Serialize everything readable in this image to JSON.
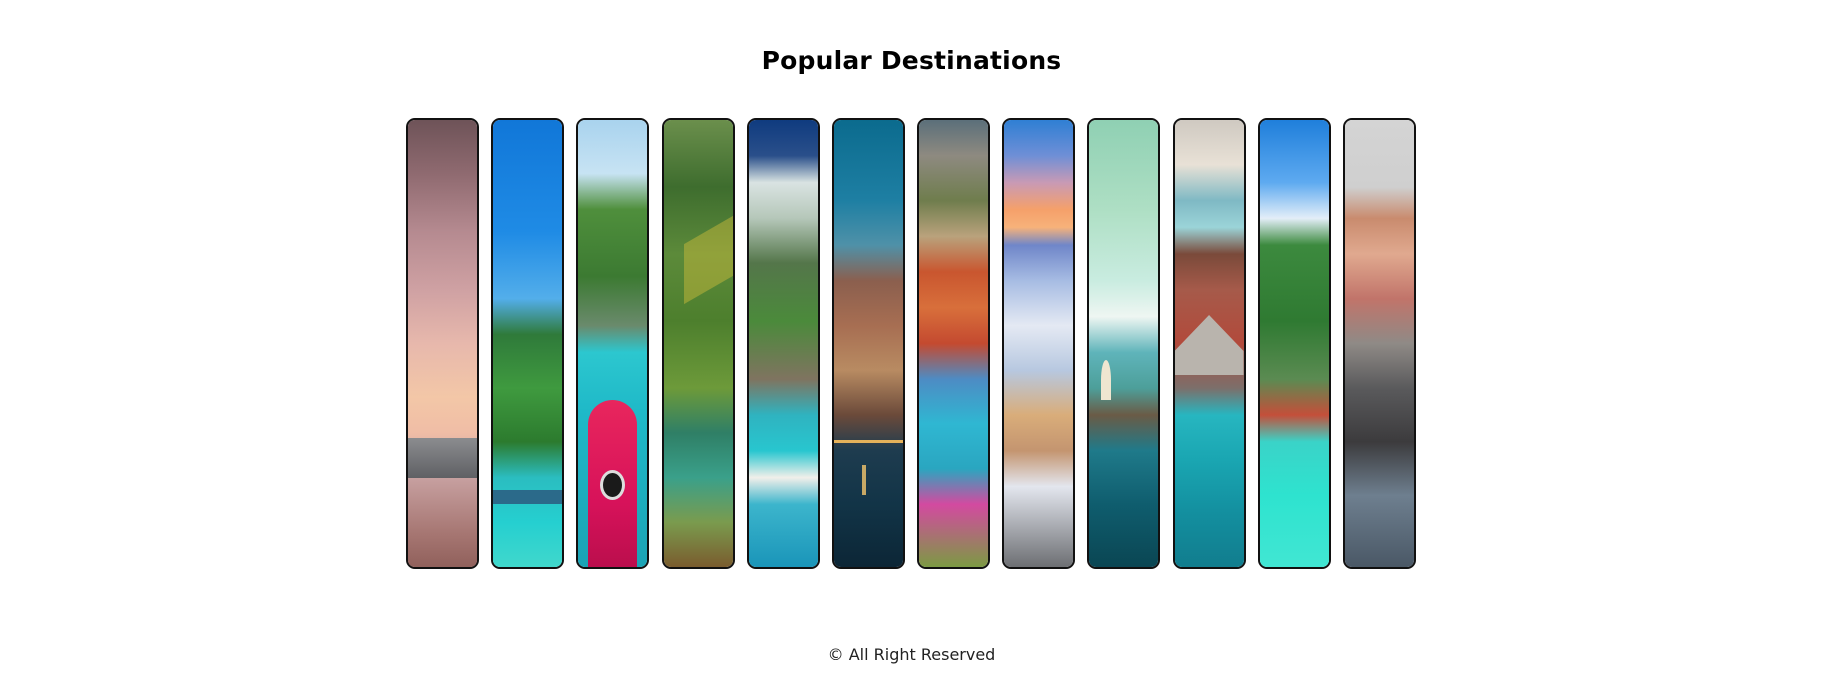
{
  "header": {
    "title": "Popular Destinations"
  },
  "footer": {
    "text": "© All Right Reserved"
  }
}
